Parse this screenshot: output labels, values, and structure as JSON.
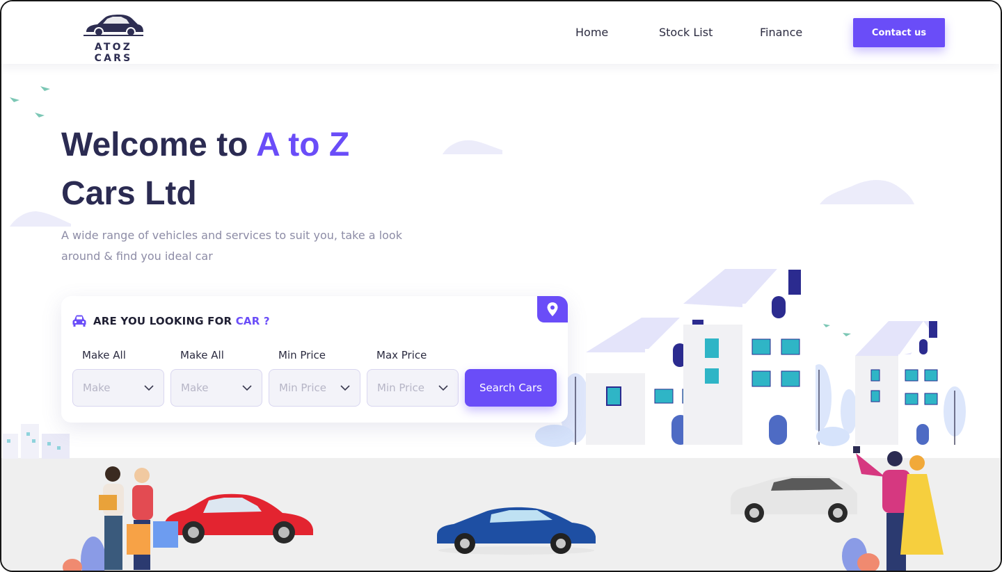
{
  "brand": {
    "name": "ATOZ CARS"
  },
  "nav": {
    "home": "Home",
    "stock_list": "Stock List",
    "finance": "Finance",
    "contact": "Contact us"
  },
  "hero": {
    "title_prefix": "Welcome to ",
    "title_accent": "A to Z",
    "title_suffix": "Cars Ltd",
    "subtitle": "A wide range of vehicles and services to suit you, take a look around & find you ideal car"
  },
  "search": {
    "title_prefix": "ARE YOU LOOKING FOR ",
    "title_accent": "CAR ?",
    "fields": [
      {
        "label": "Make All",
        "value": "Make"
      },
      {
        "label": "Make All",
        "value": "Make"
      },
      {
        "label": "Min Price",
        "value": "Min Price"
      },
      {
        "label": "Max Price",
        "value": "Min Price"
      }
    ],
    "button": "Search Cars"
  },
  "colors": {
    "accent": "#6a4df8",
    "heading": "#2b2b52",
    "muted": "#8d8ca6",
    "ground": "#efefef",
    "house_roof": "#e3e3f9",
    "house_window": "#2fb5c6",
    "door": "#4e6bc4"
  },
  "icons": [
    "logo-car-icon",
    "car-icon",
    "location-pin-icon",
    "chevron-down-icon"
  ]
}
